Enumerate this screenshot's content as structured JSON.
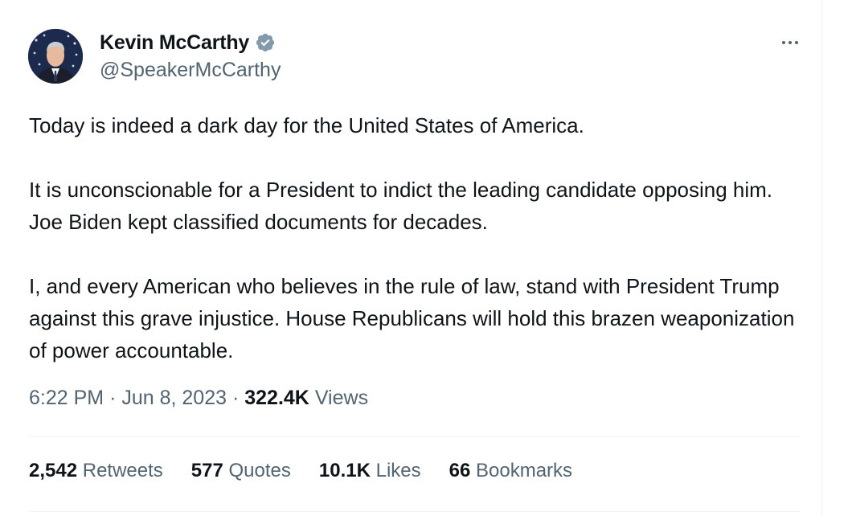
{
  "author": {
    "display_name": "Kevin McCarthy",
    "handle": "@SpeakerMcCarthy",
    "verified": true,
    "avatar_icon": "profile-photo"
  },
  "more_icon": "ellipsis-icon",
  "tweet": {
    "paragraphs": [
      "Today is indeed a dark day for the United States of America.",
      "It is unconscionable for a President to indict the leading candidate opposing him. Joe Biden kept classified documents for decades.",
      "I, and every American who believes in the rule of law, stand with President Trump against this grave injustice. House Republicans will hold this brazen weaponization of power accountable."
    ],
    "time": "6:22 PM",
    "separator": "·",
    "date": "Jun 8, 2023",
    "views_count": "322.4K",
    "views_label": "Views"
  },
  "stats": [
    {
      "count": "2,542",
      "label": "Retweets"
    },
    {
      "count": "577",
      "label": "Quotes"
    },
    {
      "count": "10.1K",
      "label": "Likes"
    },
    {
      "count": "66",
      "label": "Bookmarks"
    }
  ],
  "colors": {
    "text_primary": "#0f1419",
    "text_secondary": "#536471",
    "verified_badge": "#829aab",
    "divider": "#eff3f4"
  }
}
